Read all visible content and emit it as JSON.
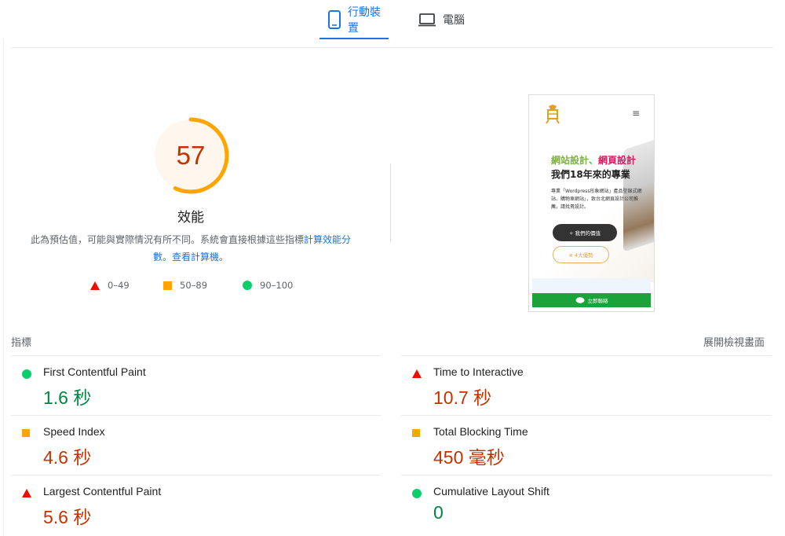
{
  "tabs": {
    "mobile": {
      "label": "行動裝置",
      "icon": "smartphone-icon",
      "active": true
    },
    "desktop": {
      "label": "電腦",
      "icon": "laptop-icon",
      "active": false
    }
  },
  "score": {
    "value": "57",
    "fraction": 0.57,
    "title": "效能",
    "desc_prefix": "此為預估值，可能與實際情況有所不同。系統會直接根據這些指標",
    "desc_link1": "計算效能分數",
    "desc_sep": "。",
    "desc_link2": "看計算機",
    "desc_link2_prefix": "查",
    "desc_end": "。",
    "color": "#ffa400"
  },
  "legend": [
    {
      "range": "0–49",
      "shape": "triangle",
      "color": "#eb0f00"
    },
    {
      "range": "50–89",
      "shape": "square",
      "color": "#ffa400"
    },
    {
      "range": "90–100",
      "shape": "circle",
      "color": "#0cce6b"
    }
  ],
  "screenshot": {
    "headline1_a": "網站設計、",
    "headline1_b": "網頁設計",
    "headline2": "我們18年來的專業",
    "paragraph": "專業「Wordpress形象網站」產品型錄式網站、購物車網站」，致台北網頁設計公司推薦，請找貴設計。",
    "button_primary": "✧ 我們的價值",
    "button_secondary": "※ 4大優勢",
    "cta": "立即聯絡",
    "menu_icon": "≡"
  },
  "metrics_section": {
    "label": "指標",
    "expand": "展開檢視畫面"
  },
  "metrics": [
    {
      "name": "First Contentful Paint",
      "value": "1.6 秒",
      "status": "good"
    },
    {
      "name": "Time to Interactive",
      "value": "10.7 秒",
      "status": "poor"
    },
    {
      "name": "Speed Index",
      "value": "4.6 秒",
      "status": "average"
    },
    {
      "name": "Total Blocking Time",
      "value": "450 毫秒",
      "status": "average"
    },
    {
      "name": "Largest Contentful Paint",
      "value": "5.6 秒",
      "status": "poor"
    },
    {
      "name": "Cumulative Layout Shift",
      "value": "0",
      "status": "good"
    }
  ]
}
